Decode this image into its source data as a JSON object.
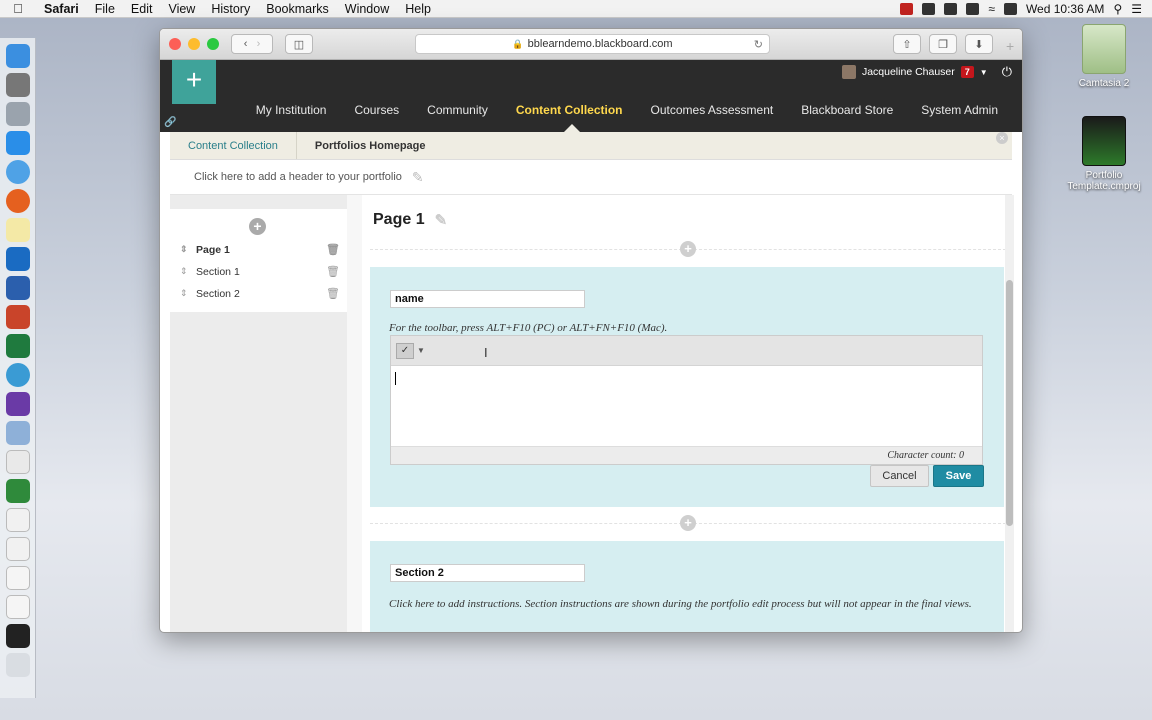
{
  "menubar": {
    "app": "Safari",
    "menus": [
      "File",
      "Edit",
      "View",
      "History",
      "Bookmarks",
      "Window",
      "Help"
    ],
    "clock": "Wed 10:36 AM"
  },
  "desktop": {
    "icons": [
      {
        "label": "Camtasia 2",
        "icon": "camtasia-disk-icon"
      },
      {
        "label": "Portfolio Template.cmproj",
        "icon": "film-project-icon"
      }
    ]
  },
  "browser": {
    "url": "bblearndemo.blackboard.com"
  },
  "bb": {
    "user_name": "Jacqueline Chauser",
    "notification_count": "7",
    "nav": [
      "My Institution",
      "Courses",
      "Community",
      "Content Collection",
      "Outcomes Assessment",
      "Blackboard Store",
      "System Admin"
    ],
    "active_tab": "Content Collection",
    "breadcrumb": [
      "Content Collection",
      "Portfolios Homepage"
    ],
    "header_prompt": "Click here to add a header to your portfolio"
  },
  "sidebar": {
    "items": [
      {
        "label": "Page 1"
      },
      {
        "label": "Section 1"
      },
      {
        "label": "Section 2"
      }
    ]
  },
  "main": {
    "page_title": "Page 1",
    "section1": {
      "name_value": "name",
      "toolbar_hint": "For the toolbar, press ALT+F10 (PC) or ALT+FN+F10 (Mac).",
      "char_count": "Character count: 0",
      "cancel": "Cancel",
      "save": "Save"
    },
    "section2": {
      "name_value": "Section 2",
      "instructions": "Click here to add instructions. Section instructions are shown during the portfolio edit process but will not appear in the final views."
    }
  }
}
